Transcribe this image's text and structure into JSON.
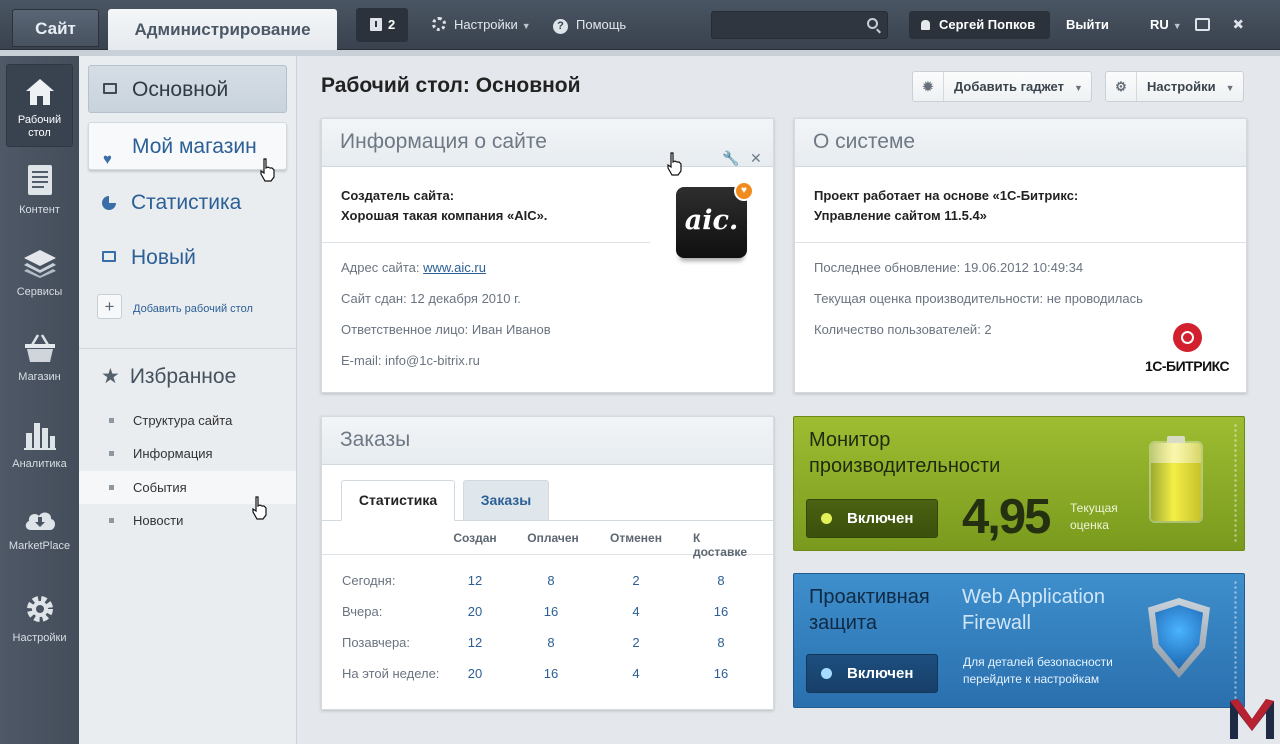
{
  "topbar": {
    "site_tab": "Сайт",
    "admin_tab": "Администрирование",
    "notifications_count": "2",
    "settings": "Настройки",
    "help": "Помощь",
    "search_placeholder": "",
    "user": "Сергей Попков",
    "logout": "Выйти",
    "lang": "RU"
  },
  "rail": [
    {
      "label": "Рабочий стол",
      "icon": "home-icon",
      "active": true
    },
    {
      "label": "Контент",
      "icon": "document-icon"
    },
    {
      "label": "Сервисы",
      "icon": "layers-icon"
    },
    {
      "label": "Магазин",
      "icon": "basket-icon"
    },
    {
      "label": "Аналитика",
      "icon": "bar-chart-icon"
    },
    {
      "label": "MarketPlace",
      "icon": "cloud-download-icon"
    },
    {
      "label": "Настройки",
      "icon": "gear-icon"
    }
  ],
  "desktops": {
    "items": [
      {
        "label": "Основной",
        "icon": "monitor-icon"
      },
      {
        "label": "Мой магазин",
        "icon": "heart-icon"
      },
      {
        "label": "Статистика",
        "icon": "pie-icon"
      },
      {
        "label": "Новый",
        "icon": "monitor-icon"
      }
    ],
    "add_label": "Добавить рабочий стол"
  },
  "favorites": {
    "title": "Избранное",
    "items": [
      "Структура сайта",
      "Информация",
      "События",
      "Новости"
    ]
  },
  "main": {
    "title": "Рабочий стол: Основной",
    "add_gadget": "Добавить гаджет",
    "settings": "Настройки"
  },
  "site_info": {
    "title": "Информация о сайте",
    "creator_label": "Создатель сайта:",
    "creator_value": "Хорошая такая компания «AIC».",
    "logo_text": "aic.",
    "address_label": "Адрес сайта:",
    "address_value": "www.aic.ru",
    "delivered": "Сайт сдан: 12 декабря 2010 г.",
    "responsible": "Ответственное лицо: Иван Иванов",
    "email": "E-mail: info@1c-bitrix.ru"
  },
  "system": {
    "title": "О системе",
    "line1": "Проект работает на основе «1С-Битрикс:",
    "line2": "Управление сайтом 11.5.4»",
    "updated": "Последнее обновление: 19.06.2012 10:49:34",
    "perf": "Текущая оценка производительности: не проводилась",
    "users": "Количество пользователей: 2",
    "logo_text": "1С-БИТРИКС"
  },
  "orders": {
    "title": "Заказы",
    "tabs": [
      "Статистика",
      "Заказы"
    ],
    "columns": [
      "Создан",
      "Оплачен",
      "Отменен",
      "К доставке"
    ],
    "rows": [
      {
        "label": "Сегодня:",
        "values": [
          "12",
          "8",
          "2",
          "8"
        ]
      },
      {
        "label": "Вчера:",
        "values": [
          "20",
          "16",
          "4",
          "16"
        ]
      },
      {
        "label": "Позавчера:",
        "values": [
          "12",
          "8",
          "2",
          "8"
        ]
      },
      {
        "label": "На этой неделе:",
        "values": [
          "20",
          "16",
          "4",
          "16"
        ]
      }
    ]
  },
  "perf_monitor": {
    "title1": "Монитор",
    "title2": "производительности",
    "button": "Включен",
    "value": "4,95",
    "caption1": "Текущая",
    "caption2": "оценка",
    "color": "#8aaa26"
  },
  "proactive": {
    "title1": "Проактивная",
    "title2": "защита",
    "button": "Включен",
    "waf1": "Web Application",
    "waf2": "Firewall",
    "caption1": "Для деталей безопасности",
    "caption2": "перейдите к настройкам",
    "color": "#3380c0"
  }
}
